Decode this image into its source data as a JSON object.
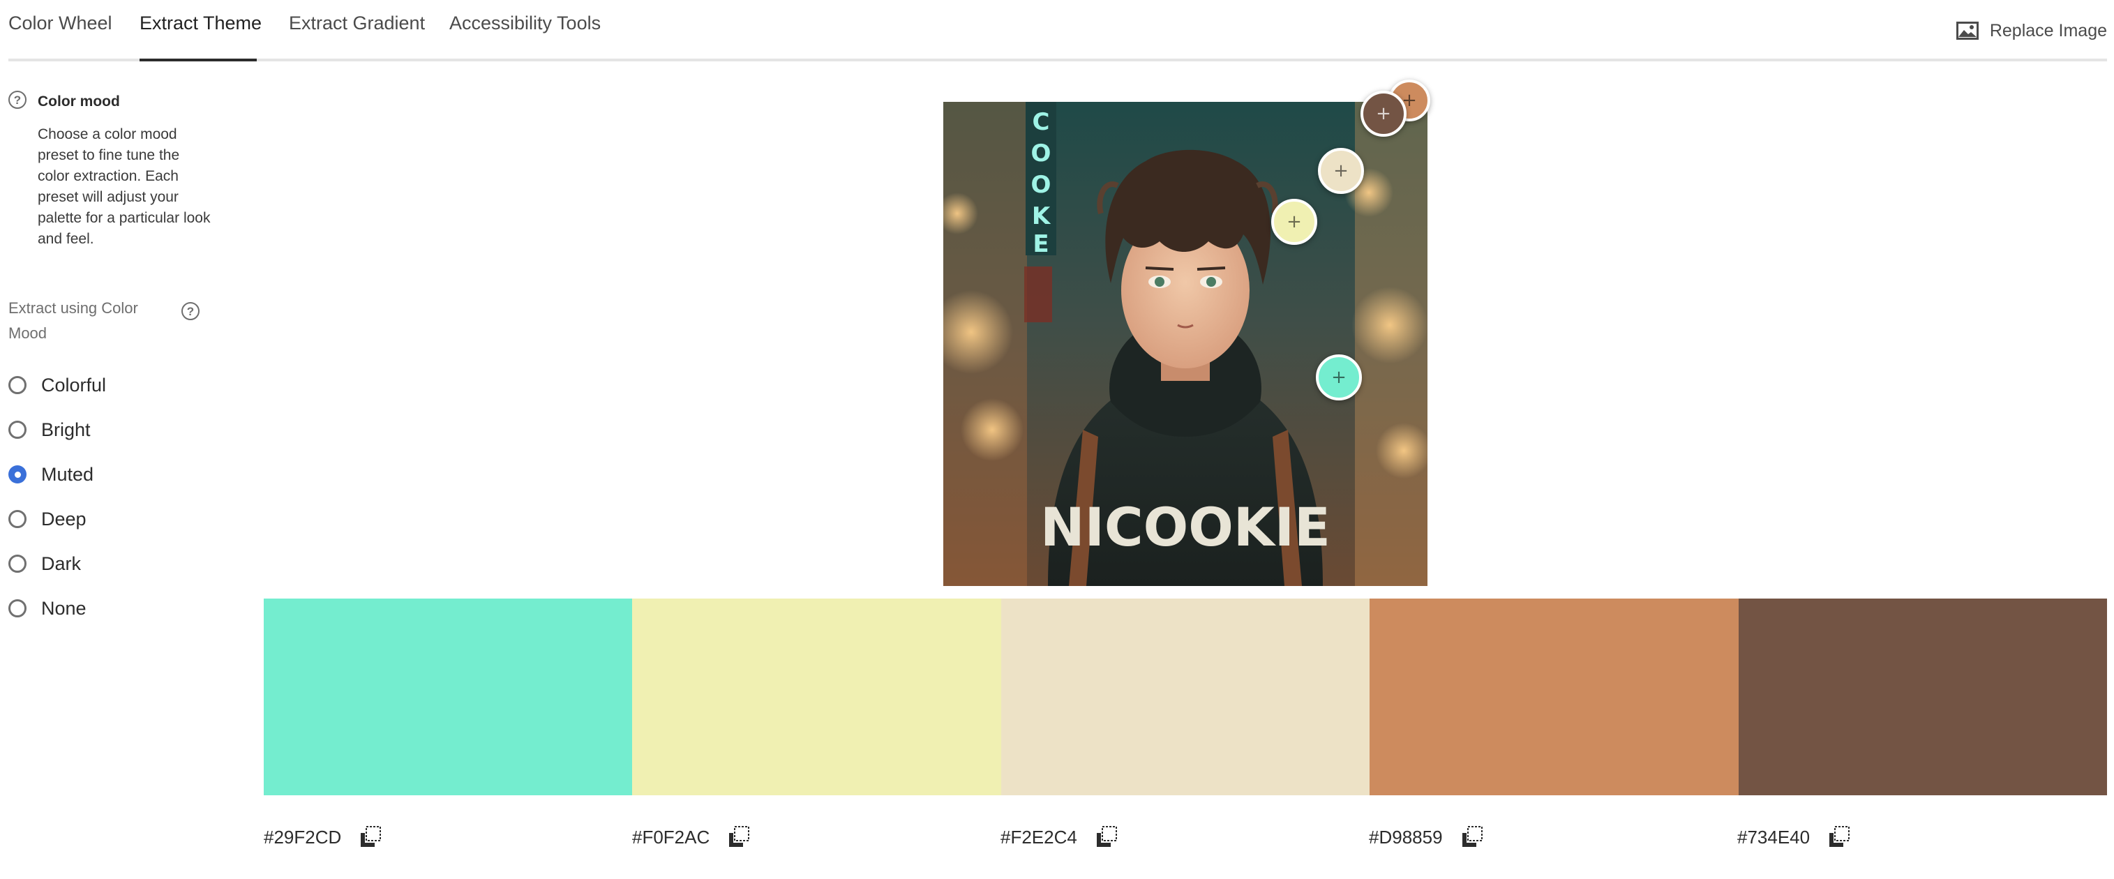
{
  "tabs": [
    {
      "label": "Color Wheel",
      "active": false
    },
    {
      "label": "Extract Theme",
      "active": true
    },
    {
      "label": "Extract Gradient",
      "active": false
    },
    {
      "label": "Accessibility Tools",
      "active": false
    }
  ],
  "replace_image": {
    "label": "Replace Image",
    "icon": "image-icon"
  },
  "mood_info": {
    "title": "Color mood",
    "description": "Choose a color mood preset to fine tune the color extraction. Each preset will adjust your palette for a particular look and feel.",
    "icon": "help-icon"
  },
  "extract_label": "Extract using Color Mood",
  "moods": [
    {
      "label": "Colorful",
      "selected": false
    },
    {
      "label": "Bright",
      "selected": false
    },
    {
      "label": "Muted",
      "selected": true
    },
    {
      "label": "Deep",
      "selected": false
    },
    {
      "label": "Dark",
      "selected": false
    },
    {
      "label": "None",
      "selected": false
    }
  ],
  "image_text": {
    "shirt_text": "NICOOKIE",
    "neon_sign": "COOKE"
  },
  "palette": [
    {
      "hex": "#29F2CD",
      "display": "#74EDCF"
    },
    {
      "hex": "#F0F2AC",
      "display": "#F0F0B2"
    },
    {
      "hex": "#F2E2C4",
      "display": "#EDE2C6"
    },
    {
      "hex": "#D98859",
      "display": "#CD8B5E"
    },
    {
      "hex": "#734E40",
      "display": "#735444"
    }
  ],
  "colors": {
    "accent": "#3A70D9",
    "divider": "#E4E4E4"
  }
}
